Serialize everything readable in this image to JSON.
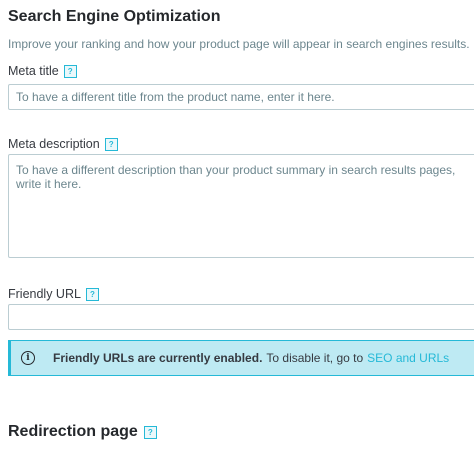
{
  "seo": {
    "title": "Search Engine Optimization",
    "subtitle": "Improve your ranking and how your product page will appear in search engines results.",
    "help_icon_text": "?",
    "meta_title": {
      "label": "Meta title",
      "placeholder": "To have a different title from the product name, enter it here.",
      "value": ""
    },
    "meta_description": {
      "label": "Meta description",
      "placeholder": "To have a different description than your product summary in search results pages, write it here.",
      "value": ""
    },
    "friendly_url": {
      "label": "Friendly URL",
      "placeholder": "",
      "value": ""
    },
    "alert": {
      "icon": "info-circle-icon",
      "strong_text": "Friendly URLs are currently enabled.",
      "text": "To disable it, go to",
      "link_text": "SEO and URLs"
    }
  },
  "redirection": {
    "title": "Redirection page"
  },
  "colors": {
    "accent": "#25b9d7",
    "alert_bg": "#beeaf3",
    "border": "#bbcdd2",
    "muted_text": "#6c868e"
  }
}
